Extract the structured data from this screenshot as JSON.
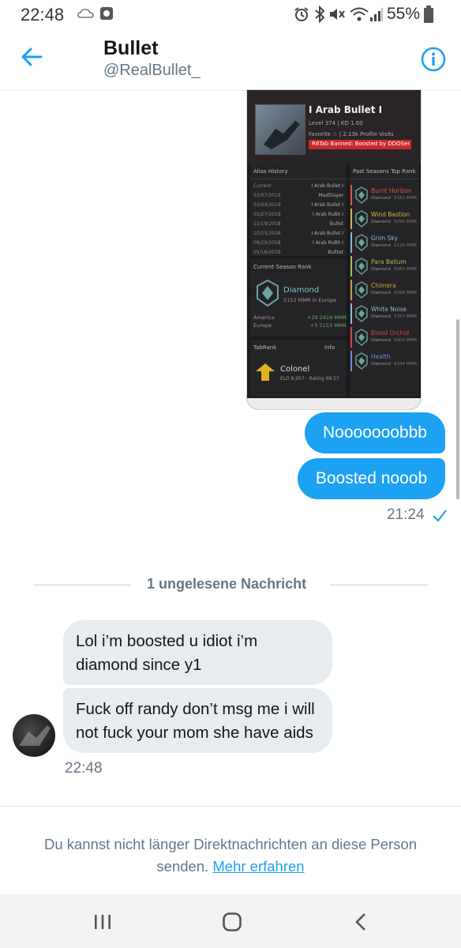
{
  "status_bar": {
    "time": "22:48",
    "battery_percent": "55%",
    "icons": [
      "cloud-icon",
      "notification-app-icon",
      "alarm-icon",
      "bluetooth-icon",
      "mute-icon",
      "wifi-icon",
      "signal-icon",
      "battery-icon"
    ]
  },
  "header": {
    "name": "Bullet",
    "handle": "@RealBullet_",
    "accent_color": "#1da1f2",
    "icons": [
      "back-arrow-icon",
      "info-icon"
    ]
  },
  "attachment": {
    "profile": {
      "name": "I Arab Bullet I",
      "level_line": "Level 374 | KD 1.60",
      "favorite_line": "Favorite ☆ | 2.13k Profile Visits",
      "banned_banner": "R6Tab Banned: Boosted by DDOSer"
    },
    "alias_history": {
      "title": "Alias History",
      "rows": [
        {
          "date": "Current",
          "name": "I Arab Bullet I"
        },
        {
          "date": "03/07/2019",
          "name": "MadSlayer"
        },
        {
          "date": "03/04/2019",
          "name": "I Arab Bullet I"
        },
        {
          "date": "01/27/2019",
          "name": "I Arab RuBh I"
        },
        {
          "date": "11/19/2018",
          "name": "Bullet"
        },
        {
          "date": "10/25/2018",
          "name": "I Arab Bullet I"
        },
        {
          "date": "09/29/2018",
          "name": "I Arab RuBh I"
        },
        {
          "date": "05/16/2018",
          "name": "Bulltet"
        }
      ]
    },
    "current_season": {
      "title": "Current Season Rank",
      "rank": "Diamond",
      "mmr_line": "5153 MMR in Europe",
      "regions": [
        {
          "name": "America",
          "value": "+29 2419 MMR"
        },
        {
          "name": "Europe",
          "value": "+5 5153 MMR"
        }
      ]
    },
    "tab_rank": {
      "title": "TabRank",
      "info": "Info",
      "rank": "Colonel",
      "elo_line": "ELO 8,957 · Rating 99.57"
    },
    "past_seasons": {
      "title": "Past Seasons Top Rank",
      "items": [
        {
          "season": "Burnt Horizon",
          "rank": "Diamond",
          "mmr": "5182 MMR",
          "color": "#e0524a"
        },
        {
          "season": "Wind Bastion",
          "rank": "Diamond",
          "mmr": "5090 MMR",
          "color": "#d9b24a"
        },
        {
          "season": "Grim Sky",
          "rank": "Diamond",
          "mmr": "5126 MMR",
          "color": "#8ab0d6"
        },
        {
          "season": "Para Bellum",
          "rank": "Diamond",
          "mmr": "5082 MMR",
          "color": "#9fbf5a"
        },
        {
          "season": "Chimera",
          "rank": "Diamond",
          "mmr": "5098 MMR",
          "color": "#c7a14a"
        },
        {
          "season": "White Noise",
          "rank": "Diamond",
          "mmr": "5357 MMR",
          "color": "#8fbcd0"
        },
        {
          "season": "Blood Orchid",
          "rank": "Diamond",
          "mmr": "5900 MMR",
          "color": "#d0464a"
        },
        {
          "season": "Health",
          "rank": "Diamond",
          "mmr": "6344 MMR",
          "color": "#6f8bd8"
        }
      ]
    }
  },
  "messages_sent": [
    {
      "text": "Nooooooobbb"
    },
    {
      "text": "Boosted nooob"
    }
  ],
  "sent_time": "21:24",
  "unread_divider": "1 ungelesene Nachricht",
  "messages_received": [
    {
      "line1": "Lol i’m boosted u idiot i’m",
      "line2": "diamond since y1"
    },
    {
      "line1": "Fuck off randy don’t msg me i will",
      "line2": "not fuck your mom she have aids"
    }
  ],
  "received_time": "22:48",
  "footer": {
    "line1": "Du kannst nicht länger Direktnachrichten an diese Person",
    "line2_prefix": "senden.",
    "link": "Mehr erfahren"
  },
  "nav_bar": {
    "icons": [
      "recent-apps-icon",
      "home-icon",
      "back-icon"
    ]
  }
}
